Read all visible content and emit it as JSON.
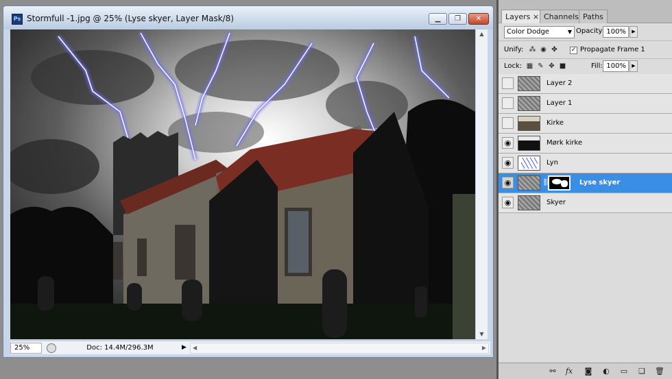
{
  "document": {
    "title": "Stormfull -1.jpg @ 25% (Lyse skyer, Layer Mask/8)",
    "app_icon": "Ps",
    "zoom": "25%",
    "doc_info": "Doc: 14.4M/296.3M",
    "window_buttons": {
      "minimize": "minimize-icon",
      "restore": "restore-icon",
      "close": "close-icon"
    }
  },
  "panel": {
    "tabs": [
      {
        "label": "Layers",
        "close": "×",
        "active": true
      },
      {
        "label": "Channels",
        "active": false
      },
      {
        "label": "Paths",
        "active": false
      }
    ],
    "blend_mode": "Color Dodge",
    "opacity_label": "Opacity:",
    "opacity_value": "100%",
    "unify_label": "Unify:",
    "propagate_label": "Propagate Frame 1",
    "propagate_checked": true,
    "lock_label": "Lock:",
    "fill_label": "Fill:",
    "fill_value": "100%",
    "layers": [
      {
        "name": "Layer 2",
        "visible": false,
        "thumb": "noise",
        "selected": false
      },
      {
        "name": "Layer 1",
        "visible": false,
        "thumb": "noise",
        "selected": false
      },
      {
        "name": "Kirke",
        "visible": false,
        "thumb": "church",
        "selected": false
      },
      {
        "name": "Mørk kirke",
        "visible": true,
        "thumb": "dark",
        "selected": false
      },
      {
        "name": "Lyn",
        "visible": true,
        "thumb": "lightning",
        "selected": false
      },
      {
        "name": "Lyse skyer",
        "visible": true,
        "thumb": "noise",
        "selected": true,
        "has_mask": true
      },
      {
        "name": "Skyer",
        "visible": true,
        "thumb": "noise",
        "selected": false
      }
    ],
    "bottom_icons": [
      "link-layers-icon",
      "fx-icon",
      "add-mask-icon",
      "adjustment-layer-icon",
      "new-group-icon",
      "new-layer-icon",
      "trash-icon"
    ]
  },
  "colors": {
    "selection": "#3a8ee6",
    "lightning": "#5a63ff"
  }
}
